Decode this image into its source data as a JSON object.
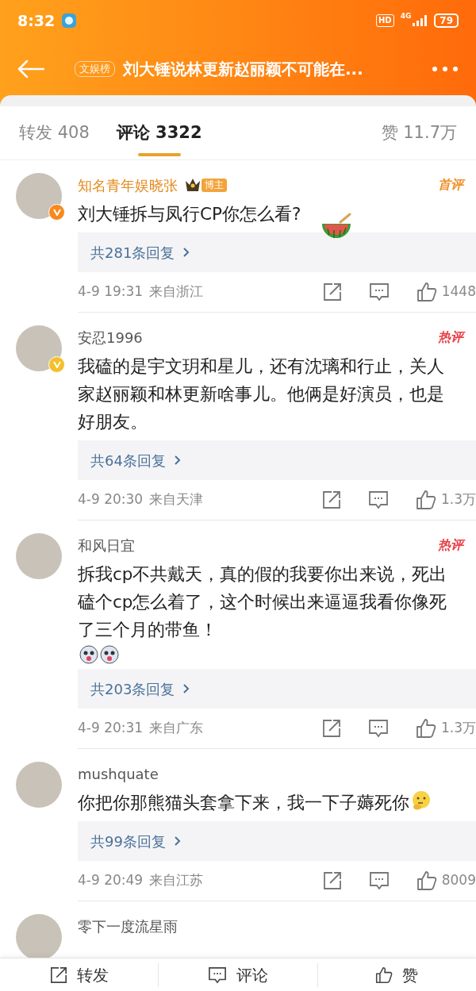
{
  "status_bar": {
    "time": "8:32",
    "hd": "HD",
    "network": "4G",
    "battery": "79"
  },
  "header": {
    "tag": "文娱榜",
    "title": "刘大锤说林更新赵丽颖不可能在..."
  },
  "tabs": [
    {
      "label": "转发",
      "count": "408",
      "selected": false
    },
    {
      "label": "评论",
      "count": "3322",
      "selected": true
    },
    {
      "label": "赞",
      "count": "11.7万",
      "selected": false
    }
  ],
  "comments": [
    {
      "name": "知名青年娱晓张",
      "vip": true,
      "role_badge": "博主",
      "verified_badge": {
        "color": "#f78a1d"
      },
      "badge": {
        "text": "首评",
        "kind": "first"
      },
      "text": "刘大锤拆与凤行CP你怎么看?",
      "stickers": [
        {
          "kind": "watermelon"
        }
      ],
      "replies": "共281条回复",
      "date": "4-9 19:31",
      "location": "来自浙江",
      "likes": "1448"
    },
    {
      "name": "安忍1996",
      "vip": false,
      "verified_badge": {
        "color": "#f5c02a"
      },
      "badge": {
        "text": "热评",
        "kind": "hot"
      },
      "text": "我磕的是宇文玥和星儿，还有沈璃和行止，关人家赵丽颖和林更新啥事儿。他俩是好演员，也是好朋友。",
      "replies": "共64条回复",
      "date": "4-9 20:30",
      "location": "来自天津",
      "likes": "1.3万"
    },
    {
      "name": "和风日宜",
      "vip": false,
      "badge": {
        "text": "热评",
        "kind": "hot"
      },
      "text": "拆我cp不共戴天，真的假的我要你出来说，死出磕个cp怎么着了，这个时候出来逼逼我看你像死了三个月的带鱼！",
      "stickers": [
        {
          "kind": "dog"
        },
        {
          "kind": "dog"
        }
      ],
      "replies": "共203条回复",
      "date": "4-9 20:31",
      "location": "来自广东",
      "likes": "1.3万"
    },
    {
      "name": "mushquate",
      "vip": false,
      "text": "你把你那熊猫头套拿下来，我一下子薅死你",
      "stickers": [
        {
          "kind": "thinking"
        }
      ],
      "replies": "共99条回复",
      "date": "4-9 20:49",
      "location": "来自江苏",
      "likes": "8009"
    },
    {
      "name": "零下一度流星雨",
      "vip": false
    }
  ],
  "bottom_bar": [
    {
      "kind": "repost",
      "label": "转发"
    },
    {
      "kind": "comment",
      "label": "评论"
    },
    {
      "kind": "like",
      "label": "赞"
    }
  ]
}
